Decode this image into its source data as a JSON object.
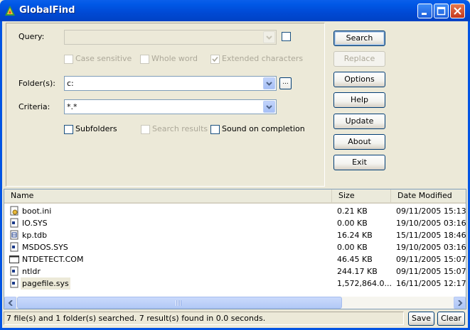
{
  "window": {
    "title": "GlobalFind"
  },
  "form": {
    "query_label": "Query:",
    "query_value": "",
    "case_sensitive_label": "Case sensitive",
    "whole_word_label": "Whole word",
    "extended_chars_label": "Extended characters",
    "folders_label": "Folder(s):",
    "folders_value": "c:",
    "browse_label": "...",
    "criteria_label": "Criteria:",
    "criteria_value": "*.*",
    "subfolders_label": "Subfolders",
    "search_results_label": "Search results",
    "sound_label": "Sound on completion"
  },
  "buttons": {
    "search": "Search",
    "replace": "Replace",
    "options": "Options",
    "help": "Help",
    "update": "Update",
    "about": "About",
    "exit": "Exit"
  },
  "list": {
    "columns": [
      "Name",
      "Size",
      "Date Modified"
    ],
    "rows": [
      {
        "name": "boot.ini",
        "size": "0.21 KB",
        "date": "09/11/2005 15:13",
        "icon": "settings-file-icon"
      },
      {
        "name": "IO.SYS",
        "size": "0.00 KB",
        "date": "19/10/2005 03:16",
        "icon": "system-file-icon"
      },
      {
        "name": "kp.tdb",
        "size": "16.24 KB",
        "date": "15/11/2005 18:46",
        "icon": "data-file-icon"
      },
      {
        "name": "MSDOS.SYS",
        "size": "0.00 KB",
        "date": "19/10/2005 03:16",
        "icon": "system-file-icon"
      },
      {
        "name": "NTDETECT.COM",
        "size": "46.45 KB",
        "date": "09/11/2005 15:07",
        "icon": "dos-app-icon"
      },
      {
        "name": "ntldr",
        "size": "244.17 KB",
        "date": "09/11/2005 15:07",
        "icon": "system-file-icon"
      },
      {
        "name": "pagefile.sys",
        "size": "1,572,864.0...",
        "date": "16/11/2005 12:17",
        "icon": "system-file-icon"
      }
    ]
  },
  "status": {
    "text": "7 file(s) and 1 folder(s) searched. 7 result(s) found in 0.0 seconds.",
    "save_label": "Save",
    "clear_label": "Clear"
  },
  "colors": {
    "title_bar": "#0054E3",
    "window_bg": "#ECE9D8",
    "close_button": "#C4381E"
  }
}
